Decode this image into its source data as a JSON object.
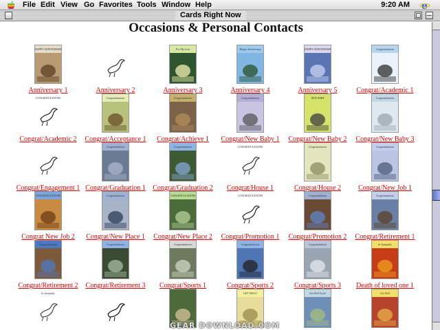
{
  "menubar": {
    "items": [
      "File",
      "Edit",
      "View",
      "Go",
      "Favorites",
      "Tools",
      "Window",
      "Help"
    ],
    "clock": "9:20 AM"
  },
  "window": {
    "title": "Cards Right Now"
  },
  "page": {
    "title": "Occasions & Personal Contacts"
  },
  "cards": [
    {
      "label": "Anniversary 1",
      "banner": "HAPPY ANNIVERSARY",
      "bg": "#b89b73",
      "fg": "#5a4024",
      "band": "#e6dcc8",
      "sketch": false
    },
    {
      "label": "Anniversary 2",
      "banner": "",
      "bg": "#ffffff",
      "fg": "#333333",
      "band": "#ffffff",
      "sketch": true
    },
    {
      "label": "Anniversary 3",
      "banner": "For My Love",
      "bg": "#2f5530",
      "fg": "#f4f0b0",
      "band": "#d8e8a4",
      "sketch": false
    },
    {
      "label": "Anniversary 4",
      "banner": "Happy Anniversary",
      "bg": "#7fb6e4",
      "fg": "#2b4f2a",
      "band": "#9ecaf0",
      "sketch": false
    },
    {
      "label": "Anniversary 5",
      "banner": "HAPPY ANNIVERSARY",
      "bg": "#5b74b4",
      "fg": "#c9d4f0",
      "band": "#dcd7ef",
      "sketch": false
    },
    {
      "label": "Congrat/Academic 1",
      "banner": "Congratulations",
      "bg": "#eaf2fb",
      "fg": "#2c2c2c",
      "band": "#b7d5f1",
      "sketch": false
    },
    {
      "label": "Congrat/Academic 2",
      "banner": "CONGRATULATIONS",
      "bg": "#ffffff",
      "fg": "#222222",
      "band": "#ffffff",
      "sketch": true
    },
    {
      "label": "Congrat/Acceptance 1",
      "banner": "Congratulations",
      "bg": "#b7c27a",
      "fg": "#6a4e2a",
      "band": "#e7ebb6",
      "sketch": false
    },
    {
      "label": "Congrat/Achieve 1",
      "banner": "Congratulations",
      "bg": "#7b6248",
      "fg": "#b48d5c",
      "band": "#c7b06c",
      "sketch": false
    },
    {
      "label": "Congrat/New Baby 1",
      "banner": "Congratulations",
      "bg": "#c9c4e2",
      "fg": "#555555",
      "band": "#b5aed8",
      "sketch": false
    },
    {
      "label": "Congrat/New Baby 2",
      "banner": "NEW BABY",
      "bg": "#d6e36b",
      "fg": "#3e3e3e",
      "band": "#d6e36b",
      "sketch": false
    },
    {
      "label": "Congrat/New Baby 3",
      "banner": "Congratulations",
      "bg": "#dfe8ee",
      "fg": "#9aa7b0",
      "band": "#c2d7e6",
      "sketch": false
    },
    {
      "label": "Congrat/Engagement 1",
      "banner": "",
      "bg": "#ffffff",
      "fg": "#333333",
      "band": "#ffffff",
      "sketch": true
    },
    {
      "label": "Congrat/Graduation 1",
      "banner": "Congratulations",
      "bg": "#6b7b94",
      "fg": "#aab6c9",
      "band": "#9fb1d2",
      "sketch": false
    },
    {
      "label": "Congrat/Graduation 2",
      "banner": "Congratulations",
      "bg": "#3d5a35",
      "fg": "#87a8d6",
      "band": "#8fb4e3",
      "sketch": false
    },
    {
      "label": "Congrat/House 1",
      "banner": "CONGRATULATIONS",
      "bg": "#ffffff",
      "fg": "#333333",
      "band": "#ffffff",
      "sketch": true
    },
    {
      "label": "Congrat/House 2",
      "banner": "Congratulations",
      "bg": "#e3e6bf",
      "fg": "#8b8b5c",
      "band": "#e3e6bf",
      "sketch": false
    },
    {
      "label": "Congrat/New Job 1",
      "banner": "Congratulations",
      "bg": "#b9c5e2",
      "fg": "#4d5b77",
      "band": "#c3cfeb",
      "sketch": false
    },
    {
      "label": "Congrat New Job 2",
      "banner": "CONGRATULATIONS",
      "bg": "#c98a42",
      "fg": "#6b3c18",
      "band": "#7ea6de",
      "sketch": false
    },
    {
      "label": "Congrat/New Place 1",
      "banner": "Congratulations",
      "bg": "#a8b3c8",
      "fg": "#2e3b55",
      "band": "#9fb1d2",
      "sketch": false
    },
    {
      "label": "Congrat/New Place 2",
      "banner": "CONGRATULATIONS",
      "bg": "#4a6b3a",
      "fg": "#b8cf9a",
      "band": "#b8dd8e",
      "sketch": false
    },
    {
      "label": "Congrat/Promotion 1",
      "banner": "CONGRATULATIONS",
      "bg": "#ffffff",
      "fg": "#222222",
      "band": "#ffffff",
      "sketch": true
    },
    {
      "label": "Congrat/Promotion 2",
      "banner": "Congratulations",
      "bg": "#6b4a35",
      "fg": "#5c86c8",
      "band": "#9fb1d2",
      "sketch": false
    },
    {
      "label": "Congrat/Retirement 1",
      "banner": "Congratulations",
      "bg": "#6a7fa6",
      "fg": "#5c3d22",
      "band": "#c3cfeb",
      "sketch": false
    },
    {
      "label": "Congrat/Retirement 2",
      "banner": "Congratulations",
      "bg": "#7d5a3a",
      "fg": "#4d79c4",
      "band": "#4d79c4",
      "sketch": false
    },
    {
      "label": "Congrat/Retirement 3",
      "banner": "Congratulations",
      "bg": "#3b4a35",
      "fg": "#a8bfa0",
      "band": "#8fb4e3",
      "sketch": false
    },
    {
      "label": "Congrat/Sports 1",
      "banner": "Congratulations",
      "bg": "#6d7a5e",
      "fg": "#cfd7c4",
      "band": "#d8d8d8",
      "sketch": false
    },
    {
      "label": "Congrat/Sports 2",
      "banner": "Congratulations",
      "bg": "#4e76b4",
      "fg": "#222222",
      "band": "#8fb4e3",
      "sketch": false
    },
    {
      "label": "Congrat/Sports 3",
      "banner": "Congratulations",
      "bg": "#9aa5b3",
      "fg": "#e6e9ee",
      "band": "#b7c6d8",
      "sketch": false
    },
    {
      "label": "Death of loved one 1",
      "banner": "In Sympathy",
      "bg": "#c63d18",
      "fg": "#f0a020",
      "band": "#f3e06a",
      "sketch": false
    },
    {
      "label": "",
      "banner": "In Sympathy",
      "bg": "#ffffff",
      "fg": "#444444",
      "band": "#ffffff",
      "sketch": true
    },
    {
      "label": "",
      "banner": "",
      "bg": "#ffffff",
      "fg": "#111111",
      "band": "#ffffff",
      "sketch": true
    },
    {
      "label": "",
      "banner": "",
      "bg": "#4c6a3a",
      "fg": "#d8c39a",
      "band": "#9fbf8e",
      "sketch": false
    },
    {
      "label": "",
      "banner": "GET WELL!",
      "bg": "#e7dc9b",
      "fg": "#9a8c4a",
      "band": "#f3ef9e",
      "sketch": false
    },
    {
      "label": "",
      "banner": "Get Well Soon!",
      "bg": "#6e8fb8",
      "fg": "#a8bf7a",
      "band": "#c2d7e6",
      "sketch": false
    },
    {
      "label": "",
      "banner": "Get Well",
      "bg": "#b7442a",
      "fg": "#e8b24a",
      "band": "#f3e06a",
      "sketch": false
    }
  ],
  "watermark": "GEAR DOWNLOAD.COM"
}
